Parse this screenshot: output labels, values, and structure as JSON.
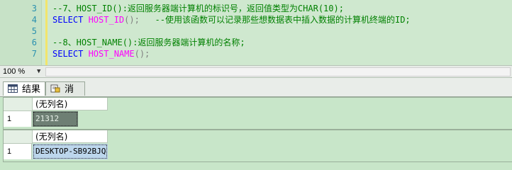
{
  "editor": {
    "lines": [
      {
        "num": "3",
        "segments": [
          {
            "cls": "cmt",
            "text": "--7、HOST_ID():返回服务器端计算机的标识号，返回值类型为CHAR(10);"
          }
        ]
      },
      {
        "num": "4",
        "segments": [
          {
            "cls": "kw",
            "text": "SELECT "
          },
          {
            "cls": "fn",
            "text": "HOST_ID"
          },
          {
            "cls": "pun",
            "text": "();"
          },
          {
            "cls": "cmt",
            "text": "   --使用该函数可以记录那些想数据表中插入数据的计算机终端的ID;"
          }
        ]
      },
      {
        "num": "5",
        "segments": [
          {
            "cls": "",
            "text": ""
          }
        ]
      },
      {
        "num": "6",
        "segments": [
          {
            "cls": "cmt",
            "text": "--8、HOST_NAME():返回服务器端计算机的名称;"
          }
        ]
      },
      {
        "num": "7",
        "segments": [
          {
            "cls": "kw",
            "text": "SELECT "
          },
          {
            "cls": "fn",
            "text": "HOST_NAME"
          },
          {
            "cls": "pun",
            "text": "();"
          }
        ]
      }
    ]
  },
  "zoom": {
    "value": "100 %"
  },
  "tabs": [
    {
      "label": "结果",
      "active": true,
      "icon": "grid-icon"
    },
    {
      "label": "消息",
      "active": false,
      "icon": "message-icon"
    }
  ],
  "results": [
    {
      "column": "(无列名)",
      "rows": [
        {
          "num": "1",
          "value": "21312"
        }
      ]
    },
    {
      "column": "(无列名)",
      "rows": [
        {
          "num": "1",
          "value": "DESKTOP-SB92BJQ"
        }
      ]
    }
  ],
  "colors": {
    "editor_bg": "#cfe8cf",
    "keyword": "#0000ff",
    "comment": "#008000",
    "function": "#ff00ff",
    "line_number": "#2b91af"
  }
}
